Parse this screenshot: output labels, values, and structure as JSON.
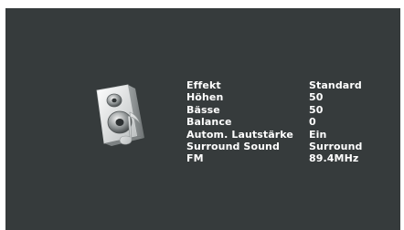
{
  "menu": {
    "icon": "speaker-music-note-icon",
    "items": [
      {
        "label": "Effekt",
        "value": "Standard"
      },
      {
        "label": "Höhen",
        "value": "50"
      },
      {
        "label": "Bässe",
        "value": "50"
      },
      {
        "label": "Balance",
        "value": "0"
      },
      {
        "label": "Autom. Lautstärke",
        "value": "Ein"
      },
      {
        "label": "Surround Sound",
        "value": "Surround"
      },
      {
        "label": "FM",
        "value": "89.4MHz"
      }
    ]
  },
  "colors": {
    "background": "#363b3c",
    "text": "#ffffff"
  }
}
